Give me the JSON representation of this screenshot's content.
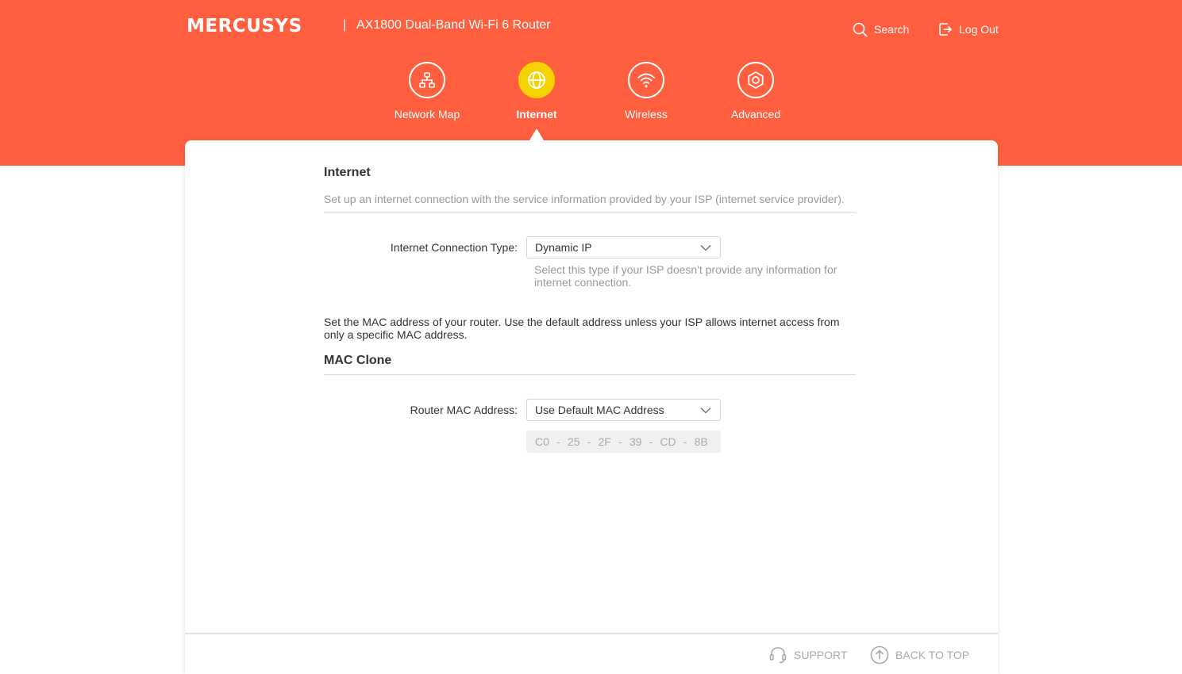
{
  "header": {
    "brand": "MERCUSYS",
    "separator": "|",
    "product_name": "AX1800 Dual-Band Wi-Fi 6 Router",
    "search_label": "Search",
    "logout_label": "Log Out"
  },
  "nav": {
    "items": [
      {
        "label": "Network Map",
        "icon": "network-map-icon",
        "active": false
      },
      {
        "label": "Internet",
        "icon": "globe-icon",
        "active": true
      },
      {
        "label": "Wireless",
        "icon": "wifi-icon",
        "active": false
      },
      {
        "label": "Advanced",
        "icon": "gear-icon",
        "active": false
      }
    ]
  },
  "internet": {
    "title": "Internet",
    "description": "Set up an internet connection with the service information provided by your ISP (internet service provider).",
    "connection_type_label": "Internet Connection Type:",
    "connection_type_value": "Dynamic IP",
    "connection_type_hint": "Select this type if your ISP doesn't provide any information for internet connection."
  },
  "mac_clone": {
    "intro": "Set the MAC address of your router. Use the default address unless your ISP allows internet access from only a specific MAC address.",
    "title": "MAC Clone",
    "router_mac_label": "Router MAC Address:",
    "router_mac_value": "Use Default MAC Address",
    "mac_octets": [
      "C0",
      "25",
      "2F",
      "39",
      "CD",
      "8B"
    ],
    "mac_separator": "-"
  },
  "footer": {
    "support_label": "SUPPORT",
    "back_to_top_label": "BACK TO TOP"
  },
  "colors": {
    "brand": "#ff5f3f",
    "active_nav": "#f5d200"
  }
}
